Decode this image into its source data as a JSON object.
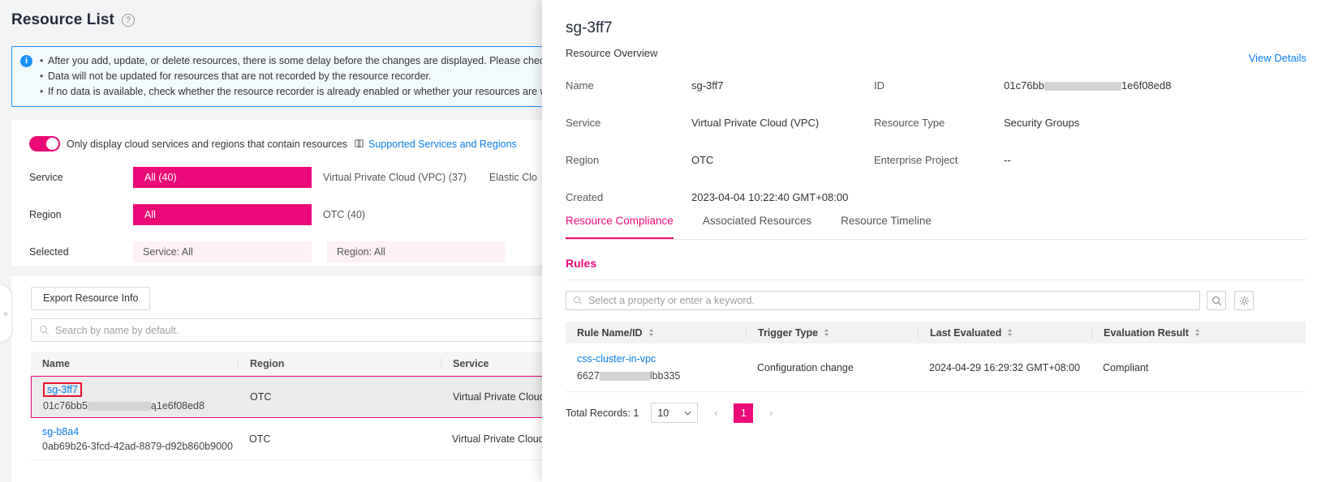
{
  "left": {
    "page_title": "Resource List",
    "help_icon": "question-circle-icon",
    "banner": {
      "icon": "info-icon",
      "lines": [
        "After you add, update, or delete resources, there is some delay before the changes are displayed. Please check again l",
        "Data will not be updated for resources that are not recorded by the resource recorder.",
        "If no data is available, check whether the resource recorder is already enabled or whether your resources are within the"
      ]
    },
    "toggle": {
      "state": "on",
      "label": "Only display cloud services and regions that contain resources",
      "link": "Supported Services and Regions",
      "link_icon": "book-icon"
    },
    "filters": {
      "service_label": "Service",
      "service_options": [
        "All (40)",
        "Virtual Private Cloud (VPC) (37)",
        "Elastic Clo"
      ],
      "region_label": "Region",
      "region_options": [
        "All",
        "OTC (40)"
      ],
      "selected_label": "Selected",
      "selected_service": "Service: All",
      "selected_region": "Region: All"
    },
    "export_button": "Export Resource Info",
    "search_placeholder": "Search by name by default.",
    "search_icon": "search-icon",
    "table": {
      "columns": [
        "Name",
        "Region",
        "Service"
      ],
      "rows": [
        {
          "name": "sg-3ff7",
          "id_prefix": "01c76bb5",
          "id_suffix": "ą1e6f08ed8",
          "region": "OTC",
          "service": "Virtual Private Cloud (V",
          "selected": true,
          "highlighted": true
        },
        {
          "name": "sg-b8a4",
          "id_prefix": "0ab69b26-3fcd-42ad-8879-d92b860b9000",
          "id_suffix": "",
          "region": "OTC",
          "service": "Virtual Private Cloud (V",
          "selected": false,
          "highlighted": false
        }
      ]
    },
    "drawer_handle_icon": "chevron-left-icon"
  },
  "panel": {
    "title": "sg-3ff7",
    "overview_label": "Resource Overview",
    "view_details": "View Details",
    "overview": [
      {
        "k": "Name",
        "v": "sg-3ff7",
        "k2": "ID",
        "v2_prefix": "01c76bb",
        "v2_suffix": "1e6f08ed8",
        "v2_masked": true
      },
      {
        "k": "Service",
        "v": "Virtual Private Cloud (VPC)",
        "k2": "Resource Type",
        "v2_prefix": "Security Groups",
        "v2_suffix": "",
        "v2_masked": false
      },
      {
        "k": "Region",
        "v": "OTC",
        "k2": "Enterprise Project",
        "v2_prefix": "--",
        "v2_suffix": "",
        "v2_masked": false
      },
      {
        "k": "Created",
        "v": "2023-04-04 10:22:40 GMT+08:00",
        "k2": "",
        "v2_prefix": "",
        "v2_suffix": "",
        "v2_masked": false
      }
    ],
    "tabs": [
      {
        "label": "Resource Compliance",
        "active": true
      },
      {
        "label": "Associated Resources",
        "active": false
      },
      {
        "label": "Resource Timeline",
        "active": false
      }
    ],
    "rules_title": "Rules",
    "rule_search_placeholder": "Select a property or enter a keyword.",
    "rule_search_icon": "search-icon",
    "search_button_icon": "search-icon",
    "settings_button_icon": "gear-icon",
    "rules_table": {
      "columns": [
        "Rule Name/ID",
        "Trigger Type",
        "Last Evaluated",
        "Evaluation Result"
      ],
      "sort_icon": "sort-icon",
      "rows": [
        {
          "rule_name": "css-cluster-in-vpc",
          "rule_id_prefix": "6627",
          "rule_id_suffix": "lbb335",
          "trigger_type": "Configuration change",
          "last_evaluated": "2024-04-29 16:29:32 GMT+08:00",
          "evaluation_result": "Compliant"
        }
      ]
    },
    "pagination": {
      "total_label": "Total Records: 1",
      "page_size": "10",
      "prev_icon": "chevron-left-icon",
      "next_icon": "chevron-right-icon",
      "current_page": "1"
    }
  },
  "colors": {
    "accent": "#eb0a78",
    "link": "#0a7de8",
    "info_border": "#1890ff",
    "highlight_box": "#e8112d"
  }
}
